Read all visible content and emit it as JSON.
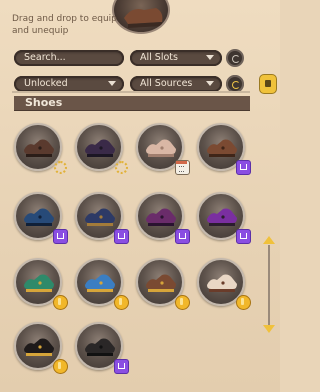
{
  "hint": "Drag and drop to equip and unequip",
  "search": {
    "placeholder": "Search..."
  },
  "filters": {
    "slots": "All Slots",
    "status": "Unlocked",
    "sources": "All Sources"
  },
  "section": {
    "title": "Shoes"
  },
  "items": [
    {
      "name": "dark-boots",
      "badge": "gear-icon",
      "colors": [
        "#5a3a2e",
        "#2b1d18"
      ]
    },
    {
      "name": "purple-lace-boots",
      "badge": "gear-icon",
      "colors": [
        "#3a2a48",
        "#1c1624"
      ]
    },
    {
      "name": "fluffy-pink-boots",
      "badge": "calendar-icon",
      "colors": [
        "#d9b7a5",
        "#a07e6e"
      ]
    },
    {
      "name": "brown-buckle-shoes",
      "badge": "twitch-icon",
      "colors": [
        "#7b4a32",
        "#3f2518"
      ]
    },
    {
      "name": "blue-curly-shoes",
      "badge": "twitch-icon",
      "colors": [
        "#274a78",
        "#102038"
      ]
    },
    {
      "name": "peg-leg-boot",
      "badge": "twitch-icon",
      "colors": [
        "#2d3a66",
        "#a37b3a"
      ]
    },
    {
      "name": "violet-buckle-shoes",
      "badge": "twitch-icon",
      "colors": [
        "#6a2c6a",
        "#2a1330"
      ]
    },
    {
      "name": "purple-curl-slippers",
      "badge": "twitch-icon",
      "colors": [
        "#7a2fa0",
        "#2b1d2e"
      ]
    },
    {
      "name": "green-gold-shoes",
      "badge": "coin-icon",
      "colors": [
        "#2e8a6a",
        "#d6a53a"
      ]
    },
    {
      "name": "blue-gold-shoes",
      "badge": "coin-icon",
      "colors": [
        "#3b7ec2",
        "#d6a53a"
      ]
    },
    {
      "name": "brown-sandals",
      "badge": "coin-icon",
      "colors": [
        "#7a4a32",
        "#d6a53a"
      ]
    },
    {
      "name": "cream-brown-shoes",
      "badge": "coin-icon",
      "colors": [
        "#e9d7c5",
        "#6a3c2a"
      ]
    },
    {
      "name": "black-gold-buckle-shoes",
      "badge": "coin-icon",
      "colors": [
        "#1e1a1a",
        "#d6a53a"
      ]
    },
    {
      "name": "black-shoes",
      "badge": "twitch-icon",
      "colors": [
        "#2a2727",
        "#111"
      ]
    }
  ],
  "colors": {
    "accent": "#f0c13b",
    "panel": "#e9d5b8",
    "section": "#6a5548"
  }
}
